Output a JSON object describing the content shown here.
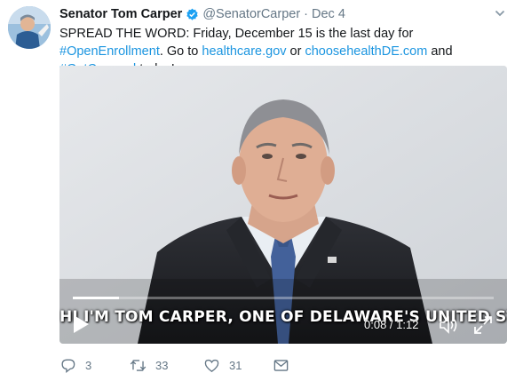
{
  "tweet": {
    "author_name": "Senator Tom Carper",
    "handle": "@SenatorCarper",
    "separator": "·",
    "date": "Dec 4",
    "text_parts": {
      "t1": "SPREAD THE WORD: Friday, December 15 is the last day for ",
      "l1": "#OpenEnrollment",
      "t2": ". Go to ",
      "l2": "healthcare.gov",
      "t3": " or ",
      "l3": "choosehealthDE.com",
      "t4": " and ",
      "l4": "#GetCovered",
      "t5": " today!"
    }
  },
  "video": {
    "caption": "HI I'M TOM CARPER, ONE OF DELAWARE'S UNITED STATES SENATORS.",
    "time_display": "0:08 / 1:12",
    "progress_fraction": 0.11
  },
  "actions": {
    "reply_count": "3",
    "retweet_count": "33",
    "like_count": "31"
  },
  "icons": {
    "verified": "verified-badge-icon",
    "caret": "chevron-down-icon",
    "play": "play-icon",
    "volume": "volume-icon",
    "fullscreen": "fullscreen-icon",
    "reply": "reply-icon",
    "retweet": "retweet-icon",
    "like": "heart-icon",
    "dm": "envelope-icon"
  },
  "colors": {
    "link": "#1b95e0",
    "secondary_text": "#657786",
    "verified_blue": "#1da1f2"
  }
}
